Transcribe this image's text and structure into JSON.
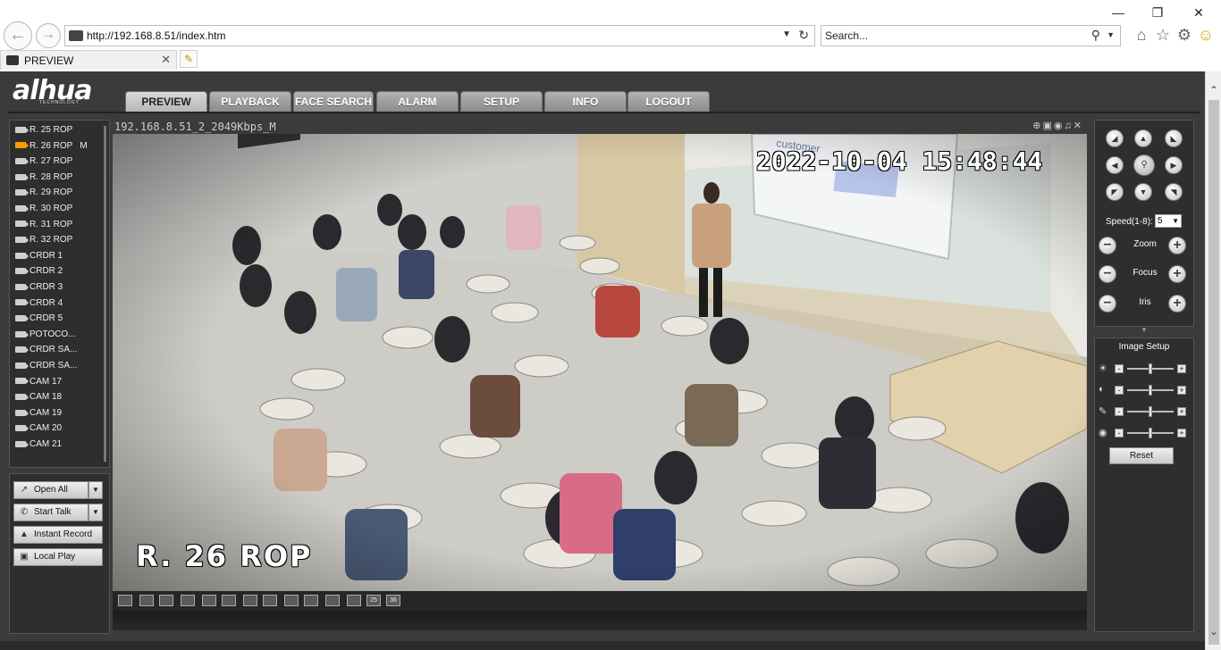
{
  "browser": {
    "url": "http://192.168.8.51/index.htm",
    "search_placeholder": "Search...",
    "tab_title": "PREVIEW",
    "window_controls": [
      "minimize-icon",
      "restore-icon",
      "close-icon"
    ]
  },
  "app": {
    "logo": "alhua",
    "logo_sub": "TECHNOLOGY",
    "nav": [
      {
        "label": "PREVIEW",
        "active": true
      },
      {
        "label": "PLAYBACK",
        "active": false
      },
      {
        "label": "FACE SEARCH",
        "active": false
      },
      {
        "label": "ALARM",
        "active": false
      },
      {
        "label": "SETUP",
        "active": false
      },
      {
        "label": "INFO",
        "active": false
      },
      {
        "label": "LOGOUT",
        "active": false
      }
    ]
  },
  "channels": [
    {
      "label": "R. 25 ROP",
      "active": false,
      "flag": ""
    },
    {
      "label": "R. 26 ROP",
      "active": true,
      "flag": "M"
    },
    {
      "label": "R. 27 ROP",
      "active": false,
      "flag": ""
    },
    {
      "label": "R. 28 ROP",
      "active": false,
      "flag": ""
    },
    {
      "label": "R. 29 ROP",
      "active": false,
      "flag": ""
    },
    {
      "label": "R. 30 ROP",
      "active": false,
      "flag": ""
    },
    {
      "label": "R. 31 ROP",
      "active": false,
      "flag": ""
    },
    {
      "label": "R. 32 ROP",
      "active": false,
      "flag": ""
    },
    {
      "label": "CRDR 1",
      "active": false,
      "flag": ""
    },
    {
      "label": "CRDR 2",
      "active": false,
      "flag": ""
    },
    {
      "label": "CRDR 3",
      "active": false,
      "flag": ""
    },
    {
      "label": "CRDR 4",
      "active": false,
      "flag": ""
    },
    {
      "label": "CRDR 5",
      "active": false,
      "flag": ""
    },
    {
      "label": "POTOCO...",
      "active": false,
      "flag": ""
    },
    {
      "label": "CRDR SA...",
      "active": false,
      "flag": ""
    },
    {
      "label": "CRDR SA...",
      "active": false,
      "flag": ""
    },
    {
      "label": "CAM 17",
      "active": false,
      "flag": ""
    },
    {
      "label": "CAM 18",
      "active": false,
      "flag": ""
    },
    {
      "label": "CAM 19",
      "active": false,
      "flag": ""
    },
    {
      "label": "CAM 20",
      "active": false,
      "flag": ""
    },
    {
      "label": "CAM 21",
      "active": false,
      "flag": ""
    }
  ],
  "controls": {
    "open_all": "Open All",
    "start_talk": "Start Talk",
    "instant_record": "Instant Record",
    "local_play": "Local Play"
  },
  "video": {
    "stream_info": "192.168.8.51_2_2049Kbps_M",
    "timestamp": "2022-10-04 15:48:44",
    "osd_name": "R. 26 ROP",
    "screen_text": "customer"
  },
  "layouts": [
    "",
    "",
    "",
    "",
    "",
    "",
    "",
    "",
    "",
    "",
    "",
    "",
    "25",
    "36"
  ],
  "ptz": {
    "speed_label": "Speed(1-8):",
    "speed_value": "5",
    "zoom_label": "Zoom",
    "focus_label": "Focus",
    "iris_label": "Iris"
  },
  "image_setup": {
    "title": "Image Setup",
    "reset": "Reset",
    "sliders": [
      {
        "icon": "brightness-icon",
        "level": 0.5
      },
      {
        "icon": "contrast-icon",
        "level": 0.5
      },
      {
        "icon": "saturation-icon",
        "level": 0.5
      },
      {
        "icon": "hue-icon",
        "level": 0.5
      }
    ]
  }
}
